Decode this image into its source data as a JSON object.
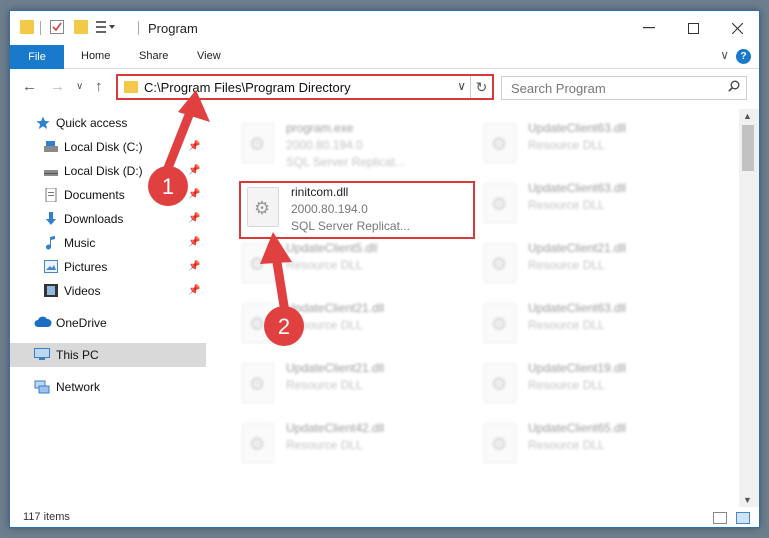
{
  "window": {
    "title": "Program"
  },
  "ribbon": {
    "tabs": [
      "File",
      "Home",
      "Share",
      "View"
    ]
  },
  "nav": {
    "address": "C:\\Program Files\\Program Directory",
    "search_placeholder": "Search Program"
  },
  "sidebar": {
    "items": [
      {
        "label": "Quick access",
        "icon": "star-icon"
      },
      {
        "label": "Local Disk (C:)",
        "icon": "drive-icon",
        "pinned": true
      },
      {
        "label": "Local Disk (D:)",
        "icon": "drive-icon",
        "pinned": true
      },
      {
        "label": "Documents",
        "icon": "documents-icon",
        "pinned": true
      },
      {
        "label": "Downloads",
        "icon": "downloads-icon",
        "pinned": true
      },
      {
        "label": "Music",
        "icon": "music-icon",
        "pinned": true
      },
      {
        "label": "Pictures",
        "icon": "pictures-icon",
        "pinned": true
      },
      {
        "label": "Videos",
        "icon": "videos-icon",
        "pinned": true
      },
      {
        "label": "OneDrive",
        "icon": "cloud-icon"
      },
      {
        "label": "This PC",
        "icon": "computer-icon",
        "selected": true
      },
      {
        "label": "Network",
        "icon": "network-icon"
      }
    ]
  },
  "files": [
    {
      "name": "program.exe",
      "line1": "2000.80.194.0",
      "line2": "SQL Server Replicat..."
    },
    {
      "name": "UpdateClient63.dll",
      "line1": "Resource DLL"
    },
    {
      "name": "rinitcom.dll",
      "line1": "2000.80.194.0",
      "line2": "SQL Server Replicat..."
    },
    {
      "name": "UpdateClient63.dll",
      "line1": "Resource DLL"
    },
    {
      "name": "UpdateClient5.dll",
      "line1": "Resource DLL"
    },
    {
      "name": "UpdateClient21.dll",
      "line1": "Resource DLL"
    },
    {
      "name": "UpdateClient21.dll",
      "line1": "Resource DLL"
    },
    {
      "name": "UpdateClient63.dll",
      "line1": "Resource DLL"
    },
    {
      "name": "UpdateClient21.dll",
      "line1": "Resource DLL"
    },
    {
      "name": "UpdateClient19.dll",
      "line1": "Resource DLL"
    },
    {
      "name": "UpdateClient42.dll",
      "line1": "Resource DLL"
    },
    {
      "name": "UpdateClient65.dll",
      "line1": "Resource DLL"
    }
  ],
  "status": {
    "items_count": "117 items"
  },
  "annotations": {
    "step1": "1",
    "step2": "2",
    "highlight_color": "#d83a3a"
  }
}
